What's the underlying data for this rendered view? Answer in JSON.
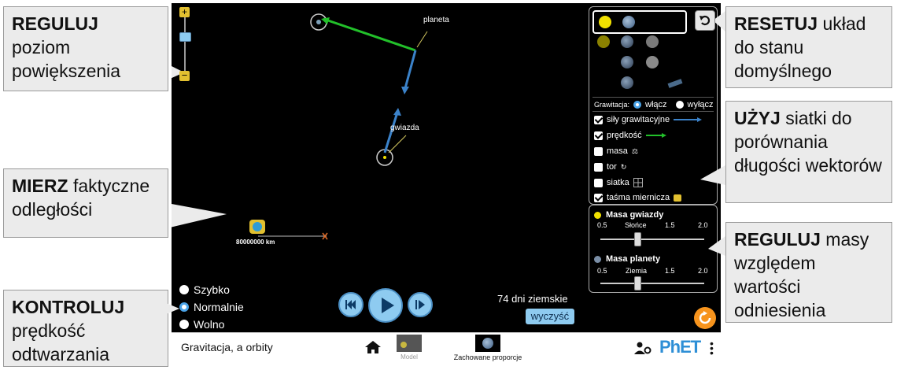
{
  "callouts": {
    "zoom": {
      "bold": "REGULUJ",
      "rest": "poziom powiększenia"
    },
    "measure": {
      "bold": "MIERZ",
      "rest": "faktyczne odległości"
    },
    "speed": {
      "bold": "KONTROLUJ",
      "rest": "prędkość odtwarzania"
    },
    "reset": {
      "bold": "RESETUJ",
      "rest": "układ do stanu domyślnego"
    },
    "grid": {
      "bold": "UŻYJ",
      "rest": "siatki do porównania długości wektorów"
    },
    "mass": {
      "bold": "REGULUJ",
      "rest": "masy względem wartości odniesienia"
    }
  },
  "sim": {
    "planet_label": "planeta",
    "star_label": "gwiazda",
    "tape_label": "80000000 km",
    "days_label": "74 dni ziemskie",
    "clear_button": "wyczyść"
  },
  "speed": {
    "options": [
      "Szybko",
      "Normalnie",
      "Wolno"
    ],
    "selected": "Normalnie"
  },
  "controls": {
    "gravity_label": "Grawitacja:",
    "gravity_on": "włącz",
    "gravity_off": "wyłącz",
    "gravity_selected": "włącz",
    "checkboxes": [
      {
        "label": "siły grawitacyjne",
        "checked": true
      },
      {
        "label": "prędkość",
        "checked": true
      },
      {
        "label": "masa",
        "checked": false
      },
      {
        "label": "tor",
        "checked": false
      },
      {
        "label": "siatka",
        "checked": false
      },
      {
        "label": "taśma miernicza",
        "checked": true
      }
    ]
  },
  "mass_panel": {
    "star_title": "Masa gwiazdy",
    "star_ticks": [
      "0.5",
      "Słońce",
      "1.5",
      "2.0"
    ],
    "planet_title": "Masa planety",
    "planet_ticks": [
      "0.5",
      "Ziemia",
      "1.5",
      "2.0"
    ]
  },
  "bottom": {
    "title": "Gravitacja, a orbity",
    "screen1_label": "Model",
    "screen2_label": "Zachowane proporcje",
    "brand": "PhET"
  },
  "colors": {
    "force_arrow": "#3b82c9",
    "velocity_arrow": "#22c02a",
    "accent_blue": "#4aa3e8",
    "reset_orange": "#f7941d"
  }
}
